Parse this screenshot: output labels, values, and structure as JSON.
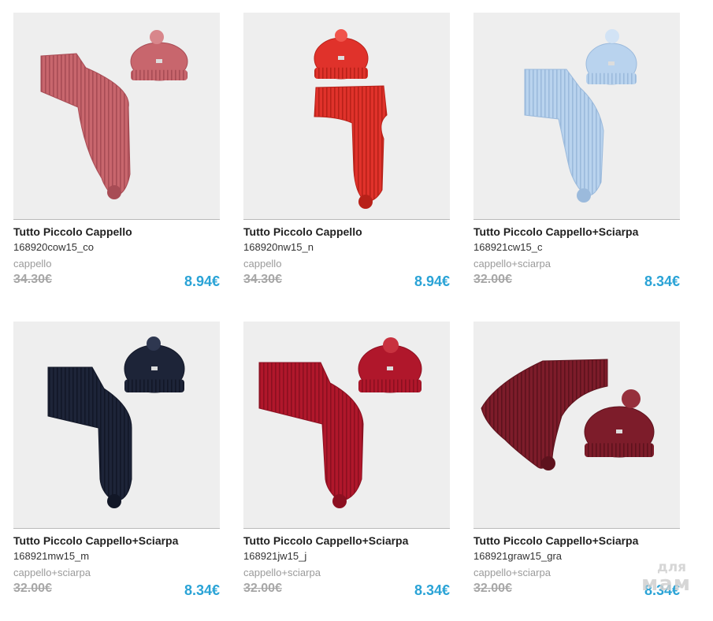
{
  "products": [
    {
      "name": "Tutto Piccolo Cappello",
      "sku": "168920cow15_co",
      "category": "cappello",
      "old_price": "34.30€",
      "price": "8.94€",
      "color": "#c8666d",
      "shade": "#a84c55",
      "light": "#d8868b",
      "image": "pink-knit-hat-and-scarf"
    },
    {
      "name": "Tutto Piccolo Cappello",
      "sku": "168920nw15_n",
      "category": "cappello",
      "old_price": "34.30€",
      "price": "8.94€",
      "color": "#e0322b",
      "shade": "#b82119",
      "light": "#f0544b",
      "image": "red-knit-hat-and-scarf"
    },
    {
      "name": "Tutto Piccolo Cappello+Sciarpa",
      "sku": "168921cw15_c",
      "category": "cappello+sciarpa",
      "old_price": "32.00€",
      "price": "8.34€",
      "color": "#b9d3ee",
      "shade": "#9bbadc",
      "light": "#d2e3f5",
      "image": "light-blue-knit-hat-and-scarf"
    },
    {
      "name": "Tutto Piccolo Cappello+Sciarpa",
      "sku": "168921mw15_m",
      "category": "cappello+sciarpa",
      "old_price": "32.00€",
      "price": "8.34€",
      "color": "#1d2438",
      "shade": "#121727",
      "light": "#2e3750",
      "image": "navy-knit-hat-and-scarf"
    },
    {
      "name": "Tutto Piccolo Cappello+Sciarpa",
      "sku": "168921jw15_j",
      "category": "cappello+sciarpa",
      "old_price": "32.00€",
      "price": "8.34€",
      "color": "#b0172b",
      "shade": "#8c0f20",
      "light": "#c8323f",
      "image": "crimson-knit-hat-and-scarf"
    },
    {
      "name": "Tutto Piccolo Cappello+Sciarpa",
      "sku": "168921graw15_gra",
      "category": "cappello+sciarpa",
      "old_price": "32.00€",
      "price": "8.34€",
      "color": "#7d1c2a",
      "shade": "#5e121d",
      "light": "#96303c",
      "image": "burgundy-knit-hat-and-scarf"
    }
  ],
  "watermark": {
    "line1": "для",
    "line2": "мам"
  }
}
